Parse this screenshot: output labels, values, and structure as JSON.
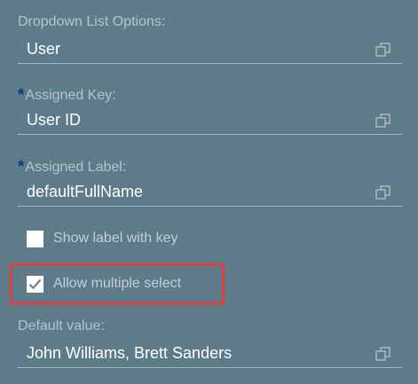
{
  "dropdown_list_options": {
    "label": "Dropdown List Options:",
    "value": "User"
  },
  "assigned_key": {
    "required_marker": "*",
    "label": "Assigned Key:",
    "value": "User ID"
  },
  "assigned_label": {
    "required_marker": "*",
    "label": "Assigned Label:",
    "value": "defaultFullName"
  },
  "show_label_with_key": {
    "label": "Show label with key",
    "checked": false
  },
  "allow_multiple_select": {
    "label": "Allow multiple select",
    "checked": true,
    "highlight_color": "#e0403b"
  },
  "default_value": {
    "label": "Default value:",
    "value": "John Williams, Brett Sanders"
  },
  "icons": {
    "picker": "value-help-icon",
    "check": "checkmark-icon"
  },
  "colors": {
    "background": "#5e7b8a",
    "label": "#b6c4cc",
    "value": "#ffffff",
    "required": "#0a3a78",
    "highlight": "#e0403b"
  }
}
